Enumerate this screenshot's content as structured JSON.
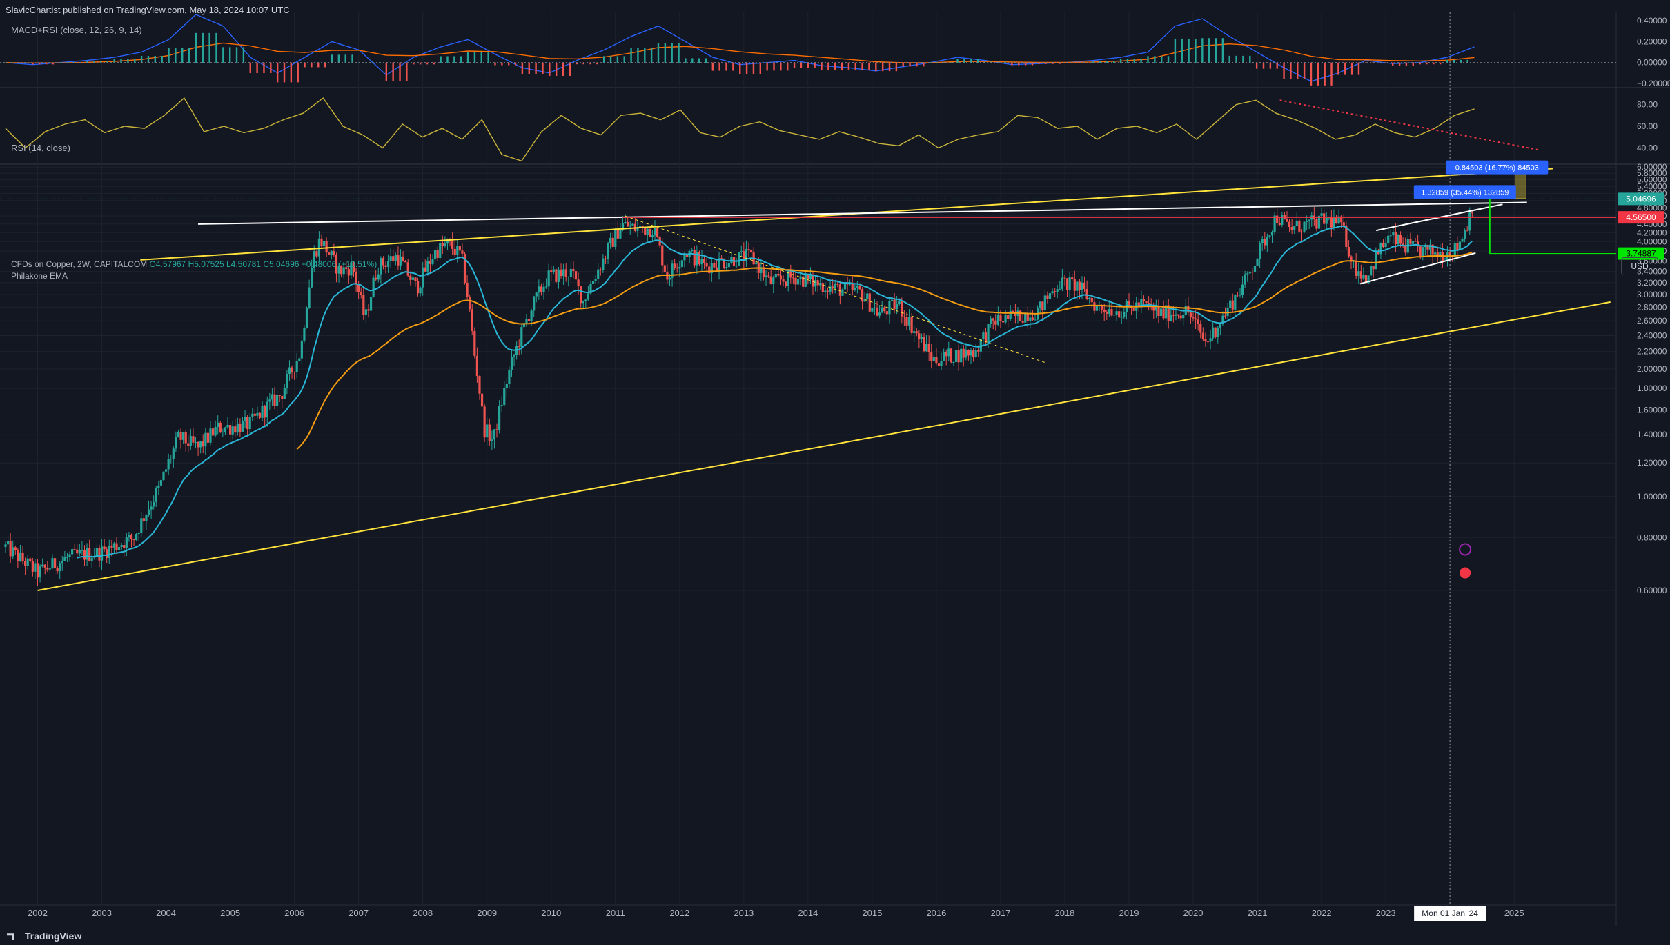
{
  "header": {
    "publisher_line": "SlavicChartist published on TradingView.com, May 18, 2024 10:07 UTC"
  },
  "macd_pane": {
    "title": "MACD+RSI (close, 12, 26, 9, 14)",
    "ticks": [
      "0.40000",
      "0.20000",
      "0.00000",
      "−0.20000"
    ]
  },
  "rsi_pane": {
    "title": "RSI (14, close)",
    "ticks": [
      "80.00",
      "60.00",
      "40.00"
    ]
  },
  "main_pane": {
    "symbol_label": "CFDs on Copper, 2W, CAPITALCOM",
    "ohlc": {
      "o": "O4.57967",
      "h": "H5.07525",
      "l": "L4.50781",
      "c": "C5.04696",
      "chg": "+0.48006 (+10.51%)"
    },
    "indicator_label": "Philakone EMA",
    "currency": "USD"
  },
  "footer": {
    "brand": "TradingView"
  },
  "colors": {
    "background": "#131722",
    "up": "#26a69a",
    "down": "#ef5350",
    "ema_fast": "#29b6d6",
    "ema_slow": "#f39c12",
    "channel": "#ffe23b",
    "resistance": "#f23645",
    "support": "#00e600"
  },
  "chart_data": {
    "type": "candlestick",
    "timeframe": "2W",
    "x_ticks": [
      "2002",
      "2003",
      "2004",
      "2005",
      "2006",
      "2007",
      "2008",
      "2009",
      "2010",
      "2011",
      "2012",
      "2013",
      "2014",
      "2015",
      "2016",
      "2017",
      "2018",
      "2019",
      "2020",
      "2021",
      "2022",
      "2023",
      "2024",
      "2025"
    ],
    "y_ticks": [
      "6.00000",
      "5.80000",
      "5.60000",
      "5.40000",
      "5.20000",
      "5.00000",
      "4.80000",
      "4.60000",
      "4.40000",
      "4.20000",
      "4.00000",
      "3.80000",
      "3.60000",
      "3.40000",
      "3.20000",
      "3.00000",
      "2.80000",
      "2.60000",
      "2.40000",
      "2.20000",
      "2.00000",
      "1.80000",
      "1.60000",
      "1.40000",
      "1.20000",
      "1.00000",
      "0.80000",
      "0.60000"
    ],
    "ylim": [
      0.58,
      6.05
    ],
    "xlim": [
      2001.5,
      2026.6
    ],
    "price_path": [
      [
        2001.5,
        0.76
      ],
      [
        2002.0,
        0.66
      ],
      [
        2002.5,
        0.72
      ],
      [
        2003.0,
        0.74
      ],
      [
        2003.5,
        0.8
      ],
      [
        2003.9,
        1.05
      ],
      [
        2004.2,
        1.38
      ],
      [
        2004.5,
        1.3
      ],
      [
        2004.8,
        1.45
      ],
      [
        2005.3,
        1.48
      ],
      [
        2005.8,
        1.75
      ],
      [
        2006.1,
        2.2
      ],
      [
        2006.3,
        3.7
      ],
      [
        2006.4,
        4.05
      ],
      [
        2006.7,
        3.4
      ],
      [
        2006.9,
        3.5
      ],
      [
        2007.1,
        2.6
      ],
      [
        2007.3,
        3.5
      ],
      [
        2007.6,
        3.7
      ],
      [
        2007.9,
        3.1
      ],
      [
        2008.2,
        3.8
      ],
      [
        2008.4,
        3.95
      ],
      [
        2008.6,
        3.7
      ],
      [
        2008.8,
        2.2
      ],
      [
        2008.95,
        1.45
      ],
      [
        2009.1,
        1.35
      ],
      [
        2009.4,
        2.1
      ],
      [
        2009.7,
        2.8
      ],
      [
        2009.95,
        3.3
      ],
      [
        2010.3,
        3.4
      ],
      [
        2010.5,
        2.9
      ],
      [
        2010.8,
        3.6
      ],
      [
        2011.1,
        4.4
      ],
      [
        2011.3,
        4.3
      ],
      [
        2011.6,
        4.3
      ],
      [
        2011.8,
        3.3
      ],
      [
        2012.1,
        3.8
      ],
      [
        2012.4,
        3.5
      ],
      [
        2012.7,
        3.6
      ],
      [
        2013.1,
        3.7
      ],
      [
        2013.4,
        3.2
      ],
      [
        2013.8,
        3.3
      ],
      [
        2014.1,
        3.2
      ],
      [
        2014.4,
        3.1
      ],
      [
        2014.8,
        3.05
      ],
      [
        2015.1,
        2.7
      ],
      [
        2015.4,
        2.85
      ],
      [
        2015.7,
        2.4
      ],
      [
        2015.95,
        2.1
      ],
      [
        2016.2,
        2.15
      ],
      [
        2016.6,
        2.2
      ],
      [
        2016.9,
        2.6
      ],
      [
        2017.2,
        2.65
      ],
      [
        2017.6,
        2.75
      ],
      [
        2017.9,
        3.2
      ],
      [
        2018.2,
        3.15
      ],
      [
        2018.5,
        2.8
      ],
      [
        2018.9,
        2.75
      ],
      [
        2019.2,
        2.85
      ],
      [
        2019.5,
        2.7
      ],
      [
        2019.9,
        2.75
      ],
      [
        2020.2,
        2.3
      ],
      [
        2020.5,
        2.7
      ],
      [
        2020.8,
        3.2
      ],
      [
        2021.0,
        3.7
      ],
      [
        2021.3,
        4.6
      ],
      [
        2021.5,
        4.3
      ],
      [
        2021.8,
        4.4
      ],
      [
        2022.1,
        4.5
      ],
      [
        2022.3,
        4.4
      ],
      [
        2022.5,
        3.5
      ],
      [
        2022.7,
        3.3
      ],
      [
        2022.9,
        3.8
      ],
      [
        2023.05,
        4.1
      ],
      [
        2023.3,
        3.9
      ],
      [
        2023.6,
        3.8
      ],
      [
        2023.9,
        3.75
      ],
      [
        2024.1,
        3.85
      ],
      [
        2024.25,
        4.3
      ],
      [
        2024.35,
        4.9
      ],
      [
        2024.38,
        5.05
      ]
    ],
    "last_price": "5.04696",
    "price_labels": [
      {
        "value": 5.04696,
        "text": "5.04696"
      },
      {
        "value": 4.565,
        "text": "4.56500"
      },
      {
        "value": 3.74887,
        "text": "3.74887"
      }
    ],
    "measure_labels": [
      {
        "text": "0.84503 (16.77%) 84503"
      },
      {
        "text": "1.32859 (35.44%) 132859"
      }
    ],
    "crosshair_x_label": "Mon 01 Jan '24",
    "rsi_values": [
      58,
      40,
      55,
      62,
      66,
      54,
      60,
      58,
      70,
      86,
      55,
      60,
      54,
      58,
      66,
      72,
      86,
      60,
      52,
      40,
      62,
      50,
      58,
      48,
      66,
      34,
      28,
      55,
      70,
      58,
      52,
      70,
      72,
      66,
      75,
      54,
      50,
      60,
      64,
      56,
      52,
      48,
      55,
      50,
      44,
      42,
      52,
      40,
      48,
      52,
      55,
      70,
      68,
      58,
      60,
      48,
      58,
      60,
      54,
      62,
      48,
      64,
      80,
      84,
      72,
      66,
      58,
      48,
      52,
      62,
      54,
      50,
      58,
      70,
      76
    ],
    "macd_values": [
      0,
      -0.02,
      0,
      0.02,
      0.05,
      0.1,
      0.22,
      0.46,
      0.35,
      0.05,
      -0.1,
      0.05,
      0.2,
      0.12,
      -0.12,
      0.05,
      0.15,
      0.22,
      0.08,
      -0.05,
      -0.1,
      0.02,
      0.12,
      0.25,
      0.35,
      0.2,
      0.05,
      -0.02,
      0,
      0.02,
      -0.03,
      -0.05,
      -0.08,
      -0.04,
      0,
      0.05,
      0.02,
      -0.02,
      -0.01,
      0,
      0.02,
      0.05,
      0.1,
      0.35,
      0.42,
      0.25,
      0.1,
      -0.05,
      -0.18,
      -0.1,
      0.02,
      -0.01,
      0,
      0.05,
      0.15
    ]
  }
}
